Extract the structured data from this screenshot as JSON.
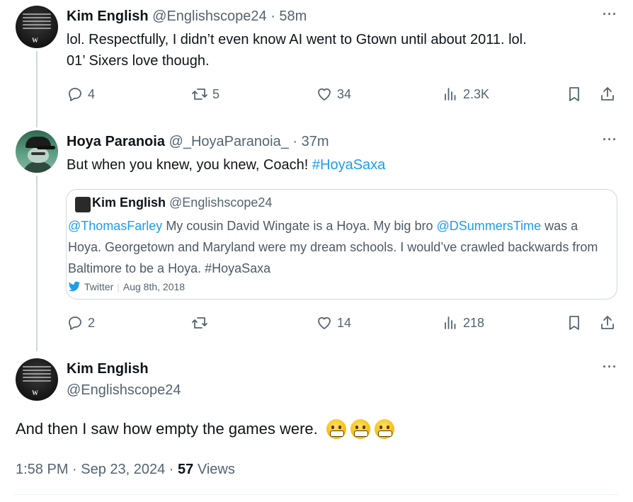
{
  "tweets": [
    {
      "name": "Kim English",
      "handle": "@Englishscope24",
      "time": "· 58m",
      "text_line1": "lol. Respectfully, I didn’t even know AI went to Gtown until about 2011. lol.",
      "text_line2": "01’ Sixers love though.",
      "replies": "4",
      "reposts": "5",
      "likes": "34",
      "views": "2.3K"
    },
    {
      "name": "Hoya Paranoia",
      "handle": "@_HoyaParanoia_",
      "time": "· 37m",
      "text": "But when you knew, you knew, Coach! ",
      "hashtag": "#HoyaSaxa",
      "replies": "2",
      "reposts": "",
      "likes": "14",
      "views": "218"
    }
  ],
  "quote": {
    "name": "Kim English",
    "handle": "@Englishscope24",
    "mention1": "@ThomasFarley",
    "text1": " My cousin David Wingate is a Hoya. My big bro ",
    "mention2": "@DSummersTime",
    "text2": " was a Hoya. Georgetown and Maryland were my dream schools. I would’ve crawled backwards from Baltimore to be a Hoya. #HoyaSaxa",
    "source": "Twitter",
    "date": "Aug 8th, 2018"
  },
  "main_tweet": {
    "name": "Kim English",
    "handle": "@Englishscope24",
    "text": "And then I saw how empty the games were.",
    "emoji_count": 3,
    "timestamp": "1:58 PM · Sep 23, 2024 · ",
    "views_count": "57",
    "views_label": " Views"
  },
  "more_label": "···",
  "icons": [
    "reply-icon",
    "repost-icon",
    "like-icon",
    "views-icon",
    "bookmark-icon",
    "share-icon",
    "twitter-bird-icon",
    "more-icon"
  ]
}
